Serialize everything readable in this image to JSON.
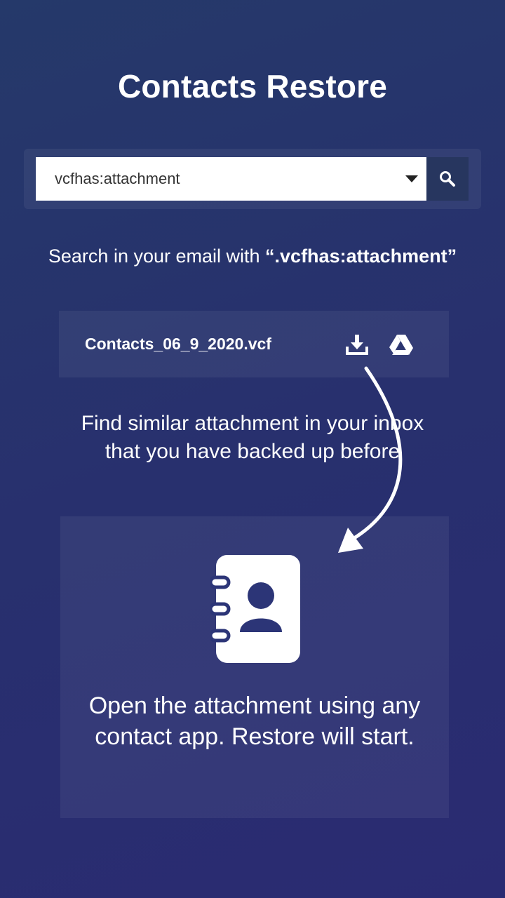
{
  "header": {
    "title": "Contacts Restore"
  },
  "search": {
    "value": "vcfhas:attachment",
    "icon": "search-icon",
    "dropdown_icon": "caret-down-icon"
  },
  "hint": {
    "prefix": "Search in your email with ",
    "query": "“.vcfhas:attachment”"
  },
  "file": {
    "name": "Contacts_06_9_2020.vcf",
    "actions": [
      "download-icon",
      "google-drive-icon"
    ]
  },
  "find_text": "Find similar attachment in your inbox that you have backed up before",
  "open_card": {
    "icon": "contact-book-icon",
    "text": "Open the attachment using any contact app. Restore will start."
  },
  "colors": {
    "background": "#28336c",
    "panel": "rgba(255,255,255,0.06)",
    "search_button": "#27365f",
    "text": "#ffffff"
  }
}
